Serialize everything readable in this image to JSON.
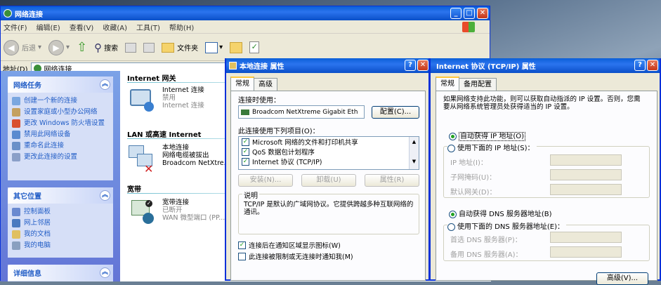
{
  "explorer": {
    "title": "网络连接",
    "menu": [
      "文件(F)",
      "编辑(E)",
      "查看(V)",
      "收藏(A)",
      "工具(T)",
      "帮助(H)"
    ],
    "toolbar": {
      "back": "后退",
      "search": "搜索",
      "folders": "文件夹"
    },
    "address_label": "地址(D)",
    "address_value": "网络连接",
    "left_panels": [
      {
        "title": "网络任务",
        "items": [
          "创建一个新的连接",
          "设置家庭或小型办公网络",
          "更改 Windows 防火墙设置",
          "禁用此网络设备",
          "重命名此连接",
          "更改此连接的设置"
        ]
      },
      {
        "title": "其它位置",
        "items": [
          "控制面板",
          "网上邻居",
          "我的文档",
          "我的电脑"
        ]
      },
      {
        "title": "详细信息",
        "items": []
      }
    ],
    "groups": {
      "internet": "Internet 网关",
      "lan": "LAN 或高速 Internet",
      "broadband": "宽带"
    },
    "connections": {
      "gateway": {
        "name": "Internet 连接",
        "status": "禁用",
        "detail": "Internet 连接"
      },
      "lan": {
        "name": "本地连接",
        "status": "网络电缆被拔出",
        "detail": "Broadcom NetXtre..."
      },
      "broadband": {
        "name": "宽带连接",
        "status": "已断开",
        "detail": "WAN 微型端口 (PP..."
      }
    }
  },
  "lan_props": {
    "title": "本地连接 属性",
    "tabs": [
      "常规",
      "高级"
    ],
    "connect_using_label": "连接时使用：",
    "adapter": "Broadcom NetXtreme Gigabit Eth",
    "configure_button": "配置(C)...",
    "items_label": "此连接使用下列项目(O)：",
    "items": [
      "Microsoft 网络的文件和打印机共享",
      "QoS 数据包计划程序",
      "Internet 协议 (TCP/IP)"
    ],
    "install_button": "安装(N)...",
    "uninstall_button": "卸载(U)",
    "properties_button": "属性(R)",
    "description_title": "说明",
    "description_text": "TCP/IP 是默认的广域网协议。它提供跨越多种互联网络的通讯。",
    "show_icon_label": "连接后在通知区域显示图标(W)",
    "notify_label": "此连接被限制或无连接时通知我(M)"
  },
  "tcpip_props": {
    "title": "Internet 协议 (TCP/IP) 属性",
    "tabs": [
      "常规",
      "备用配置"
    ],
    "intro": "如果网络支持此功能，则可以获取自动指派的 IP 设置。否则，您需要从网络系统管理员处获得适当的 IP 设置。",
    "auto_ip": "自动获得 IP 地址(O)",
    "manual_ip": "使用下面的 IP 地址(S)：",
    "ip_label": "IP 地址(I)：",
    "mask_label": "子网掩码(U)：",
    "gateway_label": "默认网关(D)：",
    "auto_dns": "自动获得 DNS 服务器地址(B)",
    "manual_dns": "使用下面的 DNS 服务器地址(E)：",
    "dns1_label": "首选 DNS 服务器(P)：",
    "dns2_label": "备用 DNS 服务器(A)：",
    "advanced_button": "高级(V)..."
  }
}
